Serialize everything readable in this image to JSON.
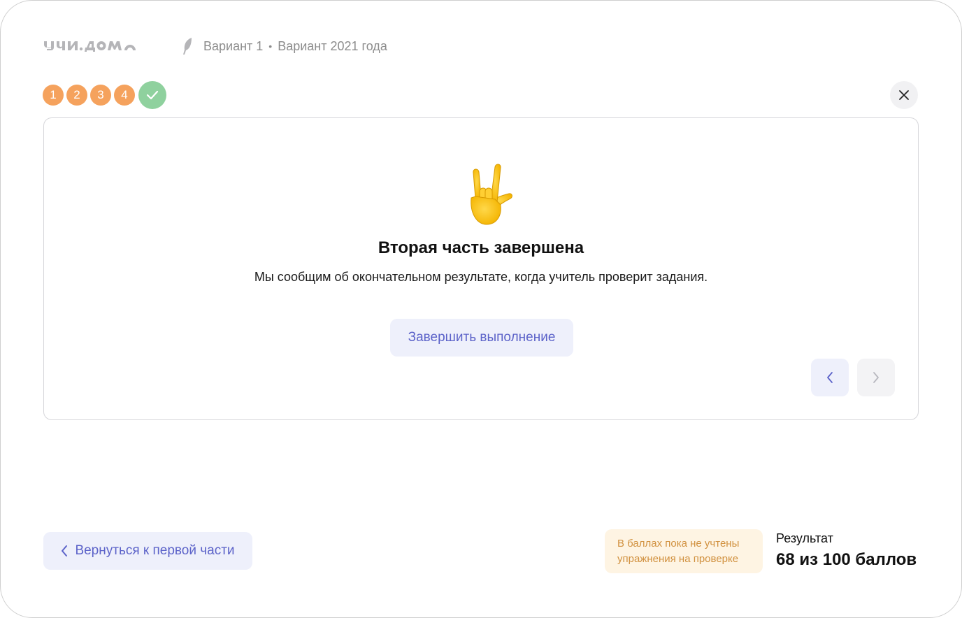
{
  "header": {
    "logo_text": "УЧИ.ДОМА",
    "variant_label": "Вариант 1",
    "separator": "•",
    "variant_year": "Вариант 2021 года",
    "feather_icon": "feather-icon"
  },
  "progress": {
    "steps": [
      "1",
      "2",
      "3",
      "4"
    ],
    "done_icon": "checkmark-icon",
    "step_color": "#f5a25d",
    "done_color": "#8fd19e"
  },
  "close_icon": "close-icon",
  "card": {
    "emoji_icon": "love-you-gesture-hand-icon",
    "title": "Вторая часть завершена",
    "text": "Мы сообщим об окончательном результате, когда учитель проверит задания.",
    "finish_label": "Завершить выполнение",
    "prev_icon": "chevron-left-icon",
    "next_icon": "chevron-right-icon"
  },
  "footer": {
    "back_label": "Вернуться к первой части",
    "notice": "В баллах пока не учтены упражнения на проверке",
    "result_label": "Результат",
    "result_value": "68 из 100 баллов"
  },
  "colors": {
    "accent": "#5c63c9",
    "accent_bg": "#eef0fb",
    "notice_bg": "#fef4e3",
    "notice_text": "#d1913f"
  }
}
